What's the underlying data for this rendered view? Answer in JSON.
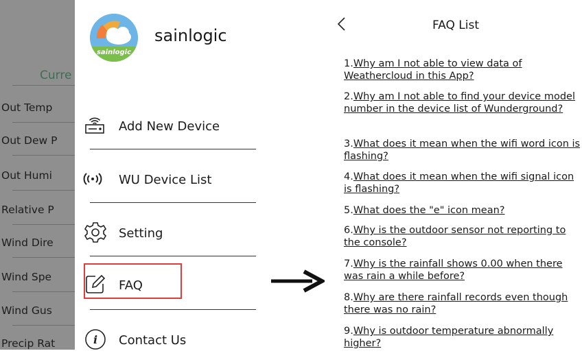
{
  "background_app": {
    "current_label": "Curre",
    "rows": [
      "Out Temp",
      "Out Dew P",
      "Out Humi",
      "Relative P",
      "Wind Dire",
      "Wind Spe",
      "Wind Gus",
      "Precip Rat"
    ]
  },
  "drawer": {
    "brand": "sainlogic",
    "logo_text": "sainlogic",
    "menu": [
      {
        "label": "Add New Device",
        "icon": "router-icon"
      },
      {
        "label": "WU Device List",
        "icon": "signal-icon"
      },
      {
        "label": "Setting",
        "icon": "gear-icon"
      },
      {
        "label": "FAQ",
        "icon": "edit-icon"
      },
      {
        "label": "Contact Us",
        "icon": "info-icon"
      }
    ]
  },
  "faq": {
    "title": "FAQ List",
    "items": [
      {
        "num": "1.",
        "q": "Why am I not able to view data of Weathercloud in this App?"
      },
      {
        "num": "2.",
        "q": "Why am I not able to find your device model number in the device list of Wunderground?"
      },
      {
        "num": "3.",
        "q": "What does it mean when the wifi word icon is flashing?"
      },
      {
        "num": "4.",
        "q": "What does it mean when the wifi signal icon is flashing?"
      },
      {
        "num": "5.",
        "q": "What does the \"e\" icon mean?"
      },
      {
        "num": "6.",
        "q": "Why is the outdoor sensor not reporting to the console?"
      },
      {
        "num": "7.",
        "q": "Why is the rainfall shows 0.00 when there was rain a while before?"
      },
      {
        "num": "8.",
        "q": "Why are there rainfall records even though there was no rain?"
      },
      {
        "num": "9.",
        "q": "Why is outdoor temperature abnormally higher?"
      }
    ]
  },
  "colors": {
    "highlight": "#e03c3c",
    "bg_dim": "#8f8f8f",
    "current_green": "#3f6d55"
  }
}
